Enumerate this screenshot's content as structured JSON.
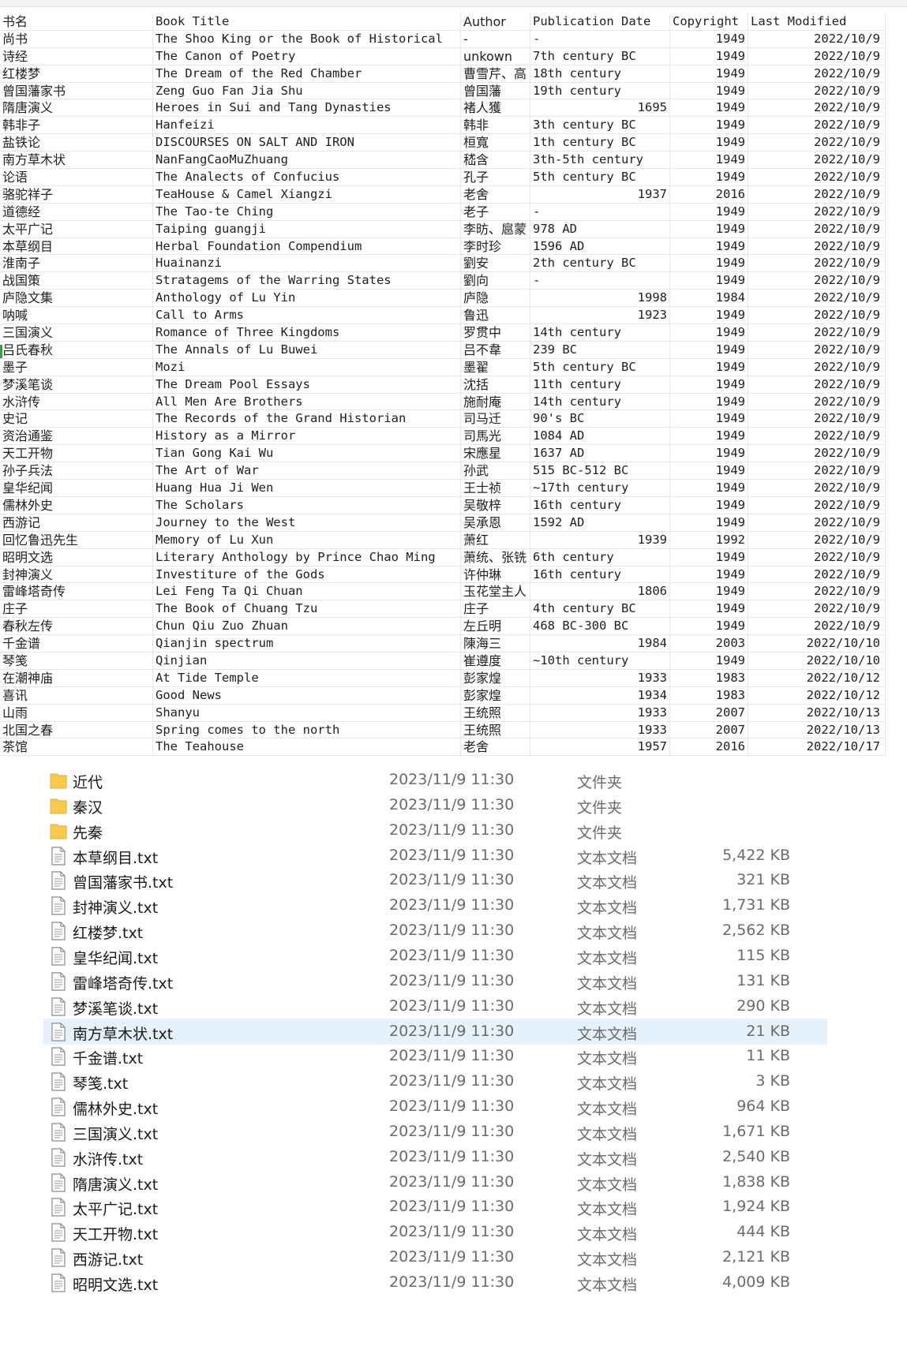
{
  "sheet": {
    "headers": [
      "书名",
      "Book Title",
      "Author",
      "Publication Date",
      "Copyright",
      "Last Modified"
    ],
    "rows": [
      [
        "尚书",
        "The Shoo King or the Book of Historical",
        "-",
        "-",
        "1949",
        "2022/10/9"
      ],
      [
        "诗经",
        "The Canon of Poetry",
        "unkown",
        "7th century BC",
        "1949",
        "2022/10/9"
      ],
      [
        "红楼梦",
        "The Dream of the Red Chamber",
        "曹雪芹、高",
        "18th century",
        "1949",
        "2022/10/9"
      ],
      [
        "曾国藩家书",
        "Zeng Guo Fan Jia Shu",
        "曾国藩",
        "19th century",
        "1949",
        "2022/10/9"
      ],
      [
        "隋唐演义",
        "Heroes in Sui and Tang Dynasties",
        "褚人獲",
        "1695",
        "1949",
        "2022/10/9"
      ],
      [
        "韩非子",
        "Hanfeizi",
        "韩非",
        "3th century BC",
        "1949",
        "2022/10/9"
      ],
      [
        "盐铁论",
        "DISCOURSES ON SALT AND IRON",
        "桓寬",
        "1th century BC",
        "1949",
        "2022/10/9"
      ],
      [
        "南方草木状",
        "NanFangCaoMuZhuang",
        "嵇含",
        "3th-5th century",
        "1949",
        "2022/10/9"
      ],
      [
        "论语",
        "The Analects of Confucius",
        "孔子",
        "5th century BC",
        "1949",
        "2022/10/9"
      ],
      [
        "骆驼祥子",
        "TeaHouse & Camel Xiangzi",
        "老舍",
        "1937",
        "2016",
        "2022/10/9"
      ],
      [
        "道德经",
        "The Tao-te Ching",
        "老子",
        "-",
        "1949",
        "2022/10/9"
      ],
      [
        "太平广记",
        "Taiping guangji",
        "李昉、扈蒙",
        "978 AD",
        "1949",
        "2022/10/9"
      ],
      [
        "本草纲目",
        "Herbal Foundation Compendium",
        "李时珍",
        "1596 AD",
        "1949",
        "2022/10/9"
      ],
      [
        "淮南子",
        "Huainanzi",
        "劉安",
        "2th century BC",
        "1949",
        "2022/10/9"
      ],
      [
        "战国策",
        "Stratagems of the Warring States",
        "劉向",
        "-",
        "1949",
        "2022/10/9"
      ],
      [
        "庐隐文集",
        "Anthology of Lu Yin",
        "庐隐",
        "1998",
        "1984",
        "2022/10/9"
      ],
      [
        "呐喊",
        "Call to Arms",
        "鲁迅",
        "1923",
        "1949",
        "2022/10/9"
      ],
      [
        "三国演义",
        "Romance of Three Kingdoms",
        "罗贯中",
        "14th century",
        "1949",
        "2022/10/9"
      ],
      [
        "吕氏春秋",
        "The Annals of Lu Buwei",
        "吕不韋",
        "239 BC",
        "1949",
        "2022/10/9"
      ],
      [
        "墨子",
        "Mozi",
        "墨翟",
        "5th century BC",
        "1949",
        "2022/10/9"
      ],
      [
        "梦溪笔谈",
        "The Dream Pool Essays",
        "沈括",
        "11th century",
        "1949",
        "2022/10/9"
      ],
      [
        "水浒传",
        "All Men Are Brothers",
        "施耐庵",
        "14th century",
        "1949",
        "2022/10/9"
      ],
      [
        "史记",
        "The Records of the Grand Historian",
        "司马迁",
        "90's BC",
        "1949",
        "2022/10/9"
      ],
      [
        "资治通鉴",
        "History as a Mirror",
        "司馬光",
        "1084 AD",
        "1949",
        "2022/10/9"
      ],
      [
        "天工开物",
        "Tian Gong Kai Wu",
        "宋應星",
        "1637 AD",
        "1949",
        "2022/10/9"
      ],
      [
        "孙子兵法",
        "The Art of War",
        "孙武",
        "515 BC-512 BC",
        "1949",
        "2022/10/9"
      ],
      [
        "皇华纪闻",
        "Huang Hua Ji Wen",
        "王士祯",
        "~17th century",
        "1949",
        "2022/10/9"
      ],
      [
        "儒林外史",
        "The Scholars",
        "吴敬梓",
        "16th century",
        "1949",
        "2022/10/9"
      ],
      [
        "西游记",
        "Journey to the West",
        "吴承恩",
        "1592 AD",
        "1949",
        "2022/10/9"
      ],
      [
        "回忆鲁迅先生",
        "Memory of Lu Xun",
        "萧红",
        "1939",
        "1992",
        "2022/10/9"
      ],
      [
        "昭明文选",
        "Literary Anthology by Prince Chao Ming",
        "萧统、张铣",
        "6th century",
        "1949",
        "2022/10/9"
      ],
      [
        "封神演义",
        "Investiture of the Gods",
        "许仲琳",
        "16th century",
        "1949",
        "2022/10/9"
      ],
      [
        "雷峰塔奇传",
        "Lei Feng Ta Qi Chuan",
        "玉花堂主人",
        "1806",
        "1949",
        "2022/10/9"
      ],
      [
        "庄子",
        "The Book of Chuang Tzu",
        "庄子",
        "4th century BC",
        "1949",
        "2022/10/9"
      ],
      [
        "春秋左传",
        "Chun Qiu Zuo Zhuan",
        "左丘明",
        "468 BC-300 BC",
        "1949",
        "2022/10/9"
      ],
      [
        "千金谱",
        "Qianjin spectrum",
        "陳海三",
        "1984",
        "2003",
        "2022/10/10"
      ],
      [
        "琴笺",
        "Qinjian",
        "崔遵度",
        "~10th century",
        "1949",
        "2022/10/10"
      ],
      [
        "在潮神庙",
        "At Tide Temple",
        "彭家煌",
        "1933",
        "1983",
        "2022/10/12"
      ],
      [
        "喜讯",
        "Good News",
        "彭家煌",
        "1934",
        "1983",
        "2022/10/12"
      ],
      [
        "山雨",
        "Shanyu",
        "王统照",
        "1933",
        "2007",
        "2022/10/13"
      ],
      [
        "北国之春",
        "Spring comes to the north",
        "王统照",
        "1933",
        "2007",
        "2022/10/13"
      ],
      [
        "茶馆",
        "The Teahouse",
        "老舍",
        "1957",
        "2016",
        "2022/10/17"
      ]
    ]
  },
  "explorer": {
    "files": [
      {
        "name": "近代",
        "date": "2023/11/9 11:30",
        "type": "文件夹",
        "size": "",
        "icon": "folder-icon"
      },
      {
        "name": "秦汉",
        "date": "2023/11/9 11:30",
        "type": "文件夹",
        "size": "",
        "icon": "folder-icon"
      },
      {
        "name": "先秦",
        "date": "2023/11/9 11:30",
        "type": "文件夹",
        "size": "",
        "icon": "folder-icon"
      },
      {
        "name": "本草纲目.txt",
        "date": "2023/11/9 11:30",
        "type": "文本文档",
        "size": "5,422 KB",
        "icon": "text-file-icon"
      },
      {
        "name": "曾国藩家书.txt",
        "date": "2023/11/9 11:30",
        "type": "文本文档",
        "size": "321 KB",
        "icon": "text-file-icon"
      },
      {
        "name": "封神演义.txt",
        "date": "2023/11/9 11:30",
        "type": "文本文档",
        "size": "1,731 KB",
        "icon": "text-file-icon"
      },
      {
        "name": "红楼梦.txt",
        "date": "2023/11/9 11:30",
        "type": "文本文档",
        "size": "2,562 KB",
        "icon": "text-file-icon"
      },
      {
        "name": "皇华纪闻.txt",
        "date": "2023/11/9 11:30",
        "type": "文本文档",
        "size": "115 KB",
        "icon": "text-file-icon"
      },
      {
        "name": "雷峰塔奇传.txt",
        "date": "2023/11/9 11:30",
        "type": "文本文档",
        "size": "131 KB",
        "icon": "text-file-icon"
      },
      {
        "name": "梦溪笔谈.txt",
        "date": "2023/11/9 11:30",
        "type": "文本文档",
        "size": "290 KB",
        "icon": "text-file-icon"
      },
      {
        "name": "南方草木状.txt",
        "date": "2023/11/9 11:30",
        "type": "文本文档",
        "size": "21 KB",
        "icon": "text-file-icon",
        "selected": true
      },
      {
        "name": "千金谱.txt",
        "date": "2023/11/9 11:30",
        "type": "文本文档",
        "size": "11 KB",
        "icon": "text-file-icon"
      },
      {
        "name": "琴笺.txt",
        "date": "2023/11/9 11:30",
        "type": "文本文档",
        "size": "3 KB",
        "icon": "text-file-icon"
      },
      {
        "name": "儒林外史.txt",
        "date": "2023/11/9 11:30",
        "type": "文本文档",
        "size": "964 KB",
        "icon": "text-file-icon"
      },
      {
        "name": "三国演义.txt",
        "date": "2023/11/9 11:30",
        "type": "文本文档",
        "size": "1,671 KB",
        "icon": "text-file-icon"
      },
      {
        "name": "水浒传.txt",
        "date": "2023/11/9 11:30",
        "type": "文本文档",
        "size": "2,540 KB",
        "icon": "text-file-icon"
      },
      {
        "name": "隋唐演义.txt",
        "date": "2023/11/9 11:30",
        "type": "文本文档",
        "size": "1,838 KB",
        "icon": "text-file-icon"
      },
      {
        "name": "太平广记.txt",
        "date": "2023/11/9 11:30",
        "type": "文本文档",
        "size": "1,924 KB",
        "icon": "text-file-icon"
      },
      {
        "name": "天工开物.txt",
        "date": "2023/11/9 11:30",
        "type": "文本文档",
        "size": "444 KB",
        "icon": "text-file-icon"
      },
      {
        "name": "西游记.txt",
        "date": "2023/11/9 11:30",
        "type": "文本文档",
        "size": "2,121 KB",
        "icon": "text-file-icon"
      },
      {
        "name": "昭明文选.txt",
        "date": "2023/11/9 11:30",
        "type": "文本文档",
        "size": "4,009 KB",
        "icon": "text-file-icon"
      }
    ],
    "colors": {
      "selected": "#e5f1fb",
      "folder": "#f8c94a",
      "meta_text": "#6b6b6b"
    }
  }
}
